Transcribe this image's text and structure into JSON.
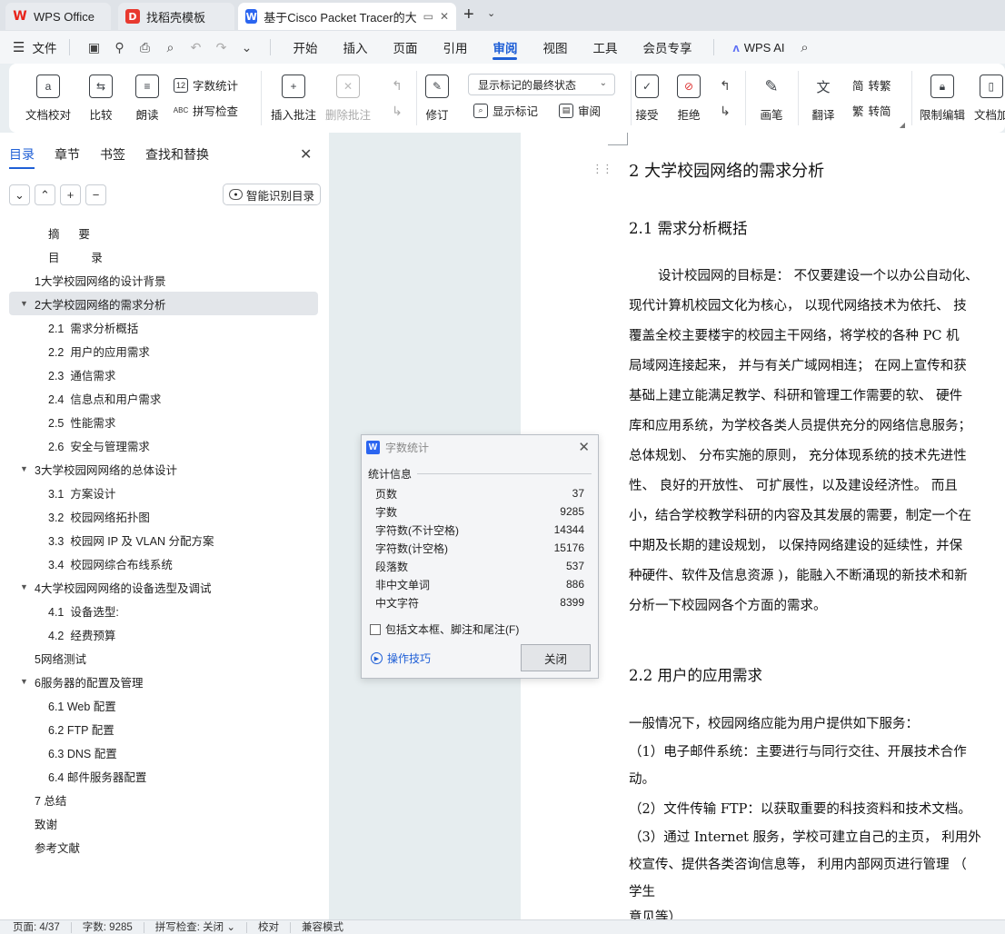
{
  "tabs": [
    {
      "label": "WPS Office",
      "icon": "wps-logo-icon"
    },
    {
      "label": "找稻壳模板",
      "icon": "docer-logo-icon"
    },
    {
      "label": "基于Cisco Packet Tracer的大",
      "icon": "writer-logo-icon",
      "active": true
    }
  ],
  "menu": {
    "file": "文件",
    "items": [
      "开始",
      "插入",
      "页面",
      "引用",
      "审阅",
      "视图",
      "工具",
      "会员专享"
    ],
    "active": "审阅",
    "ai": "WPS AI"
  },
  "ribbon": {
    "doc_check": "文档校对",
    "compare": "比较",
    "read_aloud": "朗读",
    "word_count": "字数统计",
    "spell_check": "拼写检查",
    "insert_comment": "插入批注",
    "delete_comment": "删除批注",
    "revise": "修订",
    "display_state": "显示标记的最终状态",
    "show_markup": "显示标记",
    "review_pane": "审阅",
    "accept": "接受",
    "reject": "拒绝",
    "pen": "画笔",
    "translate": "翻译",
    "to_traditional": "转繁",
    "to_simplified": "转简",
    "restrict_edit": "限制编辑",
    "doc_protect": "文档加"
  },
  "nav": {
    "tabs": [
      "目录",
      "章节",
      "书签",
      "查找和替换"
    ],
    "smart_toc": "智能识别目录",
    "toc": [
      {
        "label": "摘      要",
        "level": "spaced"
      },
      {
        "label": "目          录",
        "level": "spaced"
      },
      {
        "label": "1大学校园网络的设计背景",
        "level": "l0"
      },
      {
        "label": "2大学校园网络的需求分析",
        "level": "l0",
        "caret": "▼",
        "selected": true
      },
      {
        "label": "2.1  需求分析概括",
        "level": "l1"
      },
      {
        "label": "2.2  用户的应用需求",
        "level": "l1"
      },
      {
        "label": "2.3  通信需求",
        "level": "l1"
      },
      {
        "label": "2.4  信息点和用户需求",
        "level": "l1"
      },
      {
        "label": "2.5  性能需求",
        "level": "l1"
      },
      {
        "label": "2.6  安全与管理需求",
        "level": "l1"
      },
      {
        "label": "3大学校园网网络的总体设计",
        "level": "l0",
        "caret": "▼"
      },
      {
        "label": "3.1  方案设计",
        "level": "l1"
      },
      {
        "label": "3.2  校园网络拓扑图",
        "level": "l1"
      },
      {
        "label": "3.3  校园网 IP 及 VLAN 分配方案",
        "level": "l1"
      },
      {
        "label": "3.4  校园网综合布线系统",
        "level": "l1"
      },
      {
        "label": "4大学校园网网络的设备选型及调试",
        "level": "l0",
        "caret": "▼"
      },
      {
        "label": "4.1  设备选型:",
        "level": "l1"
      },
      {
        "label": "4.2  经费预算",
        "level": "l1"
      },
      {
        "label": "5网络测试",
        "level": "l0"
      },
      {
        "label": "6服务器的配置及管理",
        "level": "l0",
        "caret": "▼"
      },
      {
        "label": "6.1 Web 配置",
        "level": "l1"
      },
      {
        "label": "6.2 FTP 配置",
        "level": "l1"
      },
      {
        "label": "6.3 DNS 配置",
        "level": "l1"
      },
      {
        "label": "6.4 邮件服务器配置",
        "level": "l1"
      },
      {
        "label": "7 总结",
        "level": "l0"
      },
      {
        "label": "致谢",
        "level": "l0"
      },
      {
        "label": "参考文献",
        "level": "l0"
      }
    ]
  },
  "doc": {
    "h1": "2   大学校园网络的需求分析",
    "h2_1": "2.1  需求分析概括",
    "para1": [
      "设计校园网的目标是： 不仅要建设一个以办公自动化、",
      "现代计算机校园文化为核心， 以现代网络技术为依托、 技",
      "覆盖全校主要楼宇的校园主干网络，将学校的各种 PC 机",
      "局域网连接起来， 并与有关广域网相连； 在网上宣传和获",
      "基础上建立能满足教学、科研和管理工作需要的软、 硬件",
      "库和应用系统，为学校各类人员提供充分的网络信息服务；",
      "总体规划、 分布实施的原则， 充分体现系统的技术先进性",
      "性、 良好的开放性、 可扩展性，以及建设经济性。 而且",
      "小，结合学校教学科研的内容及其发展的需要，制定一个在",
      "中期及长期的建设规划， 以保持网络建设的延续性，并保",
      "种硬件、软件及信息资源 )，能融入不断涌现的新技术和新",
      "分析一下校园网各个方面的需求。"
    ],
    "h2_2": "2.2  用户的应用需求",
    "para2": [
      "一般情况下，校园网络应能为用户提供如下服务：",
      "（1）电子邮件系统：主要进行与同行交往、开展技术合作",
      "动。",
      "（2）文件传输 FTP：以获取重要的科技资料和技术文档。",
      "（3）通过 Internet 服务，学校可建立自己的主页， 利用外",
      "校宣传、提供各类咨询信息等， 利用内部网页进行管理 （",
      "学生",
      "意见等）"
    ]
  },
  "dialog": {
    "title": "字数统计",
    "section": "统计信息",
    "rows": [
      {
        "label": "页数",
        "value": "37"
      },
      {
        "label": "字数",
        "value": "9285"
      },
      {
        "label": "字符数(不计空格)",
        "value": "14344"
      },
      {
        "label": "字符数(计空格)",
        "value": "15176"
      },
      {
        "label": "段落数",
        "value": "537"
      },
      {
        "label": "非中文单词",
        "value": "886"
      },
      {
        "label": "中文字符",
        "value": "8399"
      }
    ],
    "include_label": "包括文本框、脚注和尾注(F)",
    "tips": "操作技巧",
    "close": "关闭"
  },
  "status": {
    "page": "页面: 4/37",
    "words": "字数: 9285",
    "spell": "拼写检查: 关闭 ⌄",
    "proof": "校对",
    "compat": "兼容模式"
  }
}
